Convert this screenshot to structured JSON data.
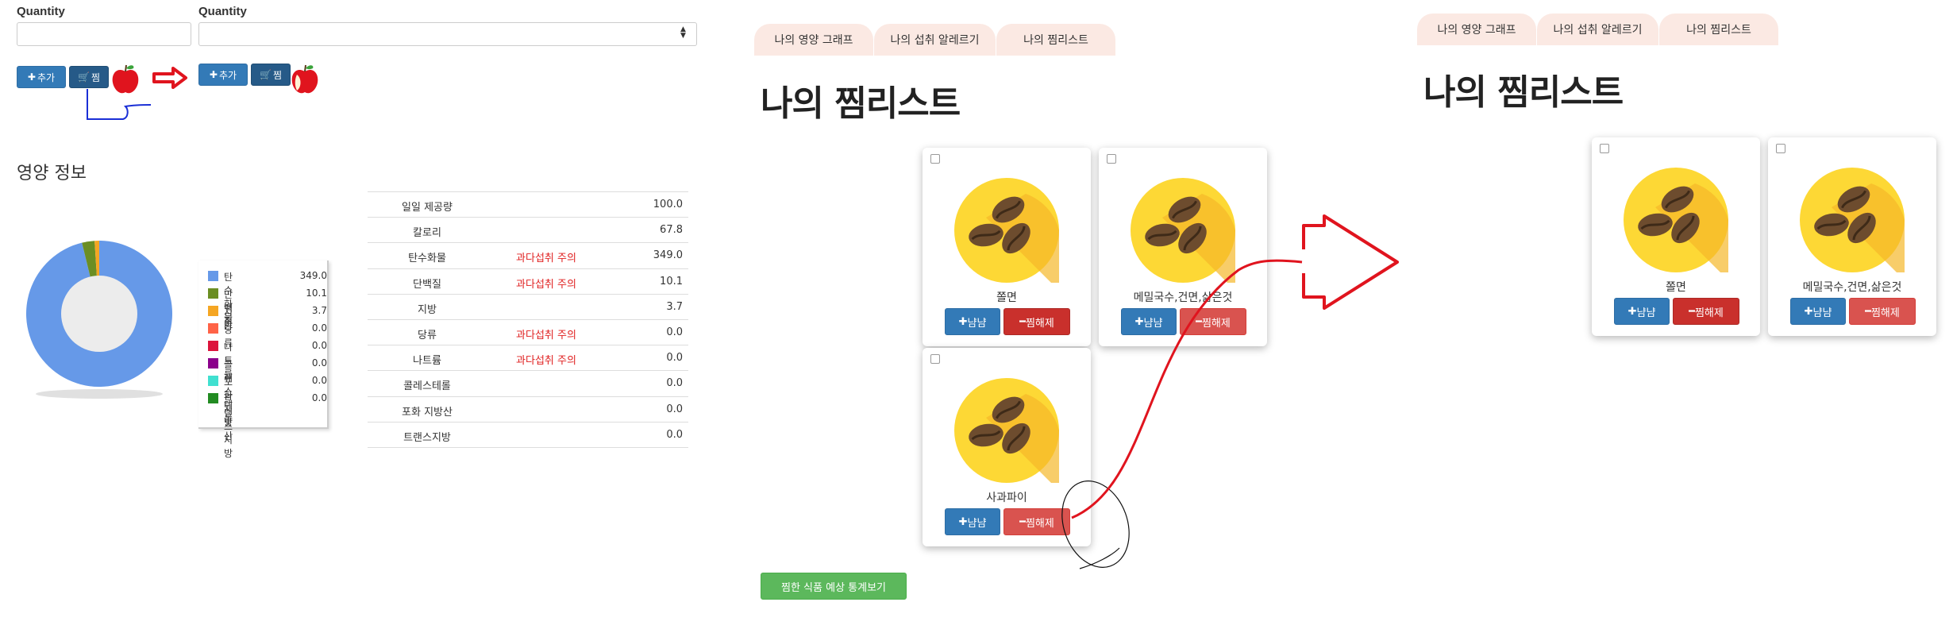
{
  "quantity_panel_before": {
    "label": "Quantity",
    "add_label": "추가",
    "save_label": "찜"
  },
  "quantity_panel_after": {
    "label": "Quantity",
    "add_label": "추가",
    "save_label": "찜"
  },
  "nutrition": {
    "title": "영양 정보",
    "legend": [
      {
        "name": "탄수화물",
        "value": "349.0",
        "color": "#6699e8"
      },
      {
        "name": "단백질",
        "value": "10.1",
        "color": "#6b8e23"
      },
      {
        "name": "지방",
        "value": "3.7",
        "color": "#f5a623"
      },
      {
        "name": "당류",
        "value": "0.0",
        "color": "#ff6347"
      },
      {
        "name": "나트륨",
        "value": "0.0",
        "color": "#dc143c"
      },
      {
        "name": "콜레스테롤",
        "value": "0.0",
        "color": "#8b008b"
      },
      {
        "name": "포화 지방산",
        "value": "0.0",
        "color": "#40e0d0"
      },
      {
        "name": "트랜스지방",
        "value": "0.0",
        "color": "#228b22"
      }
    ],
    "table": [
      {
        "label": "일일 제공량",
        "warn": "",
        "value": "100.0"
      },
      {
        "label": "칼로리",
        "warn": "",
        "value": "67.8"
      },
      {
        "label": "탄수화물",
        "warn": "과다섭취 주의",
        "value": "349.0"
      },
      {
        "label": "단백질",
        "warn": "과다섭취 주의",
        "value": "10.1"
      },
      {
        "label": "지방",
        "warn": "",
        "value": "3.7"
      },
      {
        "label": "당류",
        "warn": "과다섭취 주의",
        "value": "0.0"
      },
      {
        "label": "나트륨",
        "warn": "과다섭취 주의",
        "value": "0.0"
      },
      {
        "label": "콜레스테롤",
        "warn": "",
        "value": "0.0"
      },
      {
        "label": "포화 지방산",
        "warn": "",
        "value": "0.0"
      },
      {
        "label": "트랜스지방",
        "warn": "",
        "value": "0.0"
      }
    ],
    "warn_color": "#e02020"
  },
  "wishlist_before": {
    "tabs": [
      "나의 영양 그래프",
      "나의 섭취 알레르기",
      "나의 찜리스트"
    ],
    "title": "나의 찜리스트",
    "cards": [
      {
        "name": "쫄면",
        "eat_label": "냠냠",
        "remove_label": "찜해제"
      },
      {
        "name": "메밀국수,건면,삶은것",
        "eat_label": "냠냠",
        "remove_label": "찜해제"
      },
      {
        "name": "사과파이",
        "eat_label": "냠냠",
        "remove_label": "찜해제"
      }
    ],
    "stats_button": "찜한 식품 예상 통계보기"
  },
  "wishlist_after": {
    "tabs": [
      "나의 영양 그래프",
      "나의 섭취 알레르기",
      "나의 찜리스트"
    ],
    "title": "나의 찜리스트",
    "cards": [
      {
        "name": "쫄면",
        "eat_label": "냠냠",
        "remove_label": "찜해제"
      },
      {
        "name": "메밀국수,건면,삶은것",
        "eat_label": "냠냠",
        "remove_label": "찜해제"
      }
    ]
  },
  "colors": {
    "annotation_red": "#e0141e",
    "annotation_blue": "#1a2fd6",
    "tab_bg": "#fbe9e3"
  }
}
